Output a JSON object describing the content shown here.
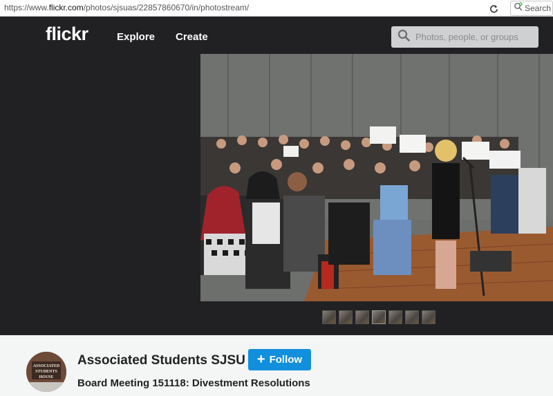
{
  "browser": {
    "url_prefix": "https://www.",
    "url_host": "flickr.com",
    "url_path": "/photos/sjsuas/22857860670/in/photostream/",
    "search_label": "Search"
  },
  "header": {
    "logo": "flickr",
    "nav": [
      "Explore",
      "Create"
    ],
    "search_placeholder": "Photos, people, or groups"
  },
  "photo": {
    "thumbnail_count": 7,
    "active_thumbnail_index": 3
  },
  "owner": {
    "name": "Associated Students SJSU",
    "follow_label": "Follow",
    "avatar_text": [
      "ASSOCIATED",
      "STUDENTS",
      "HOUSE"
    ]
  },
  "photo_title": "Board Meeting 151118: Divestment Resolutions",
  "colors": {
    "brand_dark": "#212124",
    "follow_blue": "#128fdc"
  }
}
